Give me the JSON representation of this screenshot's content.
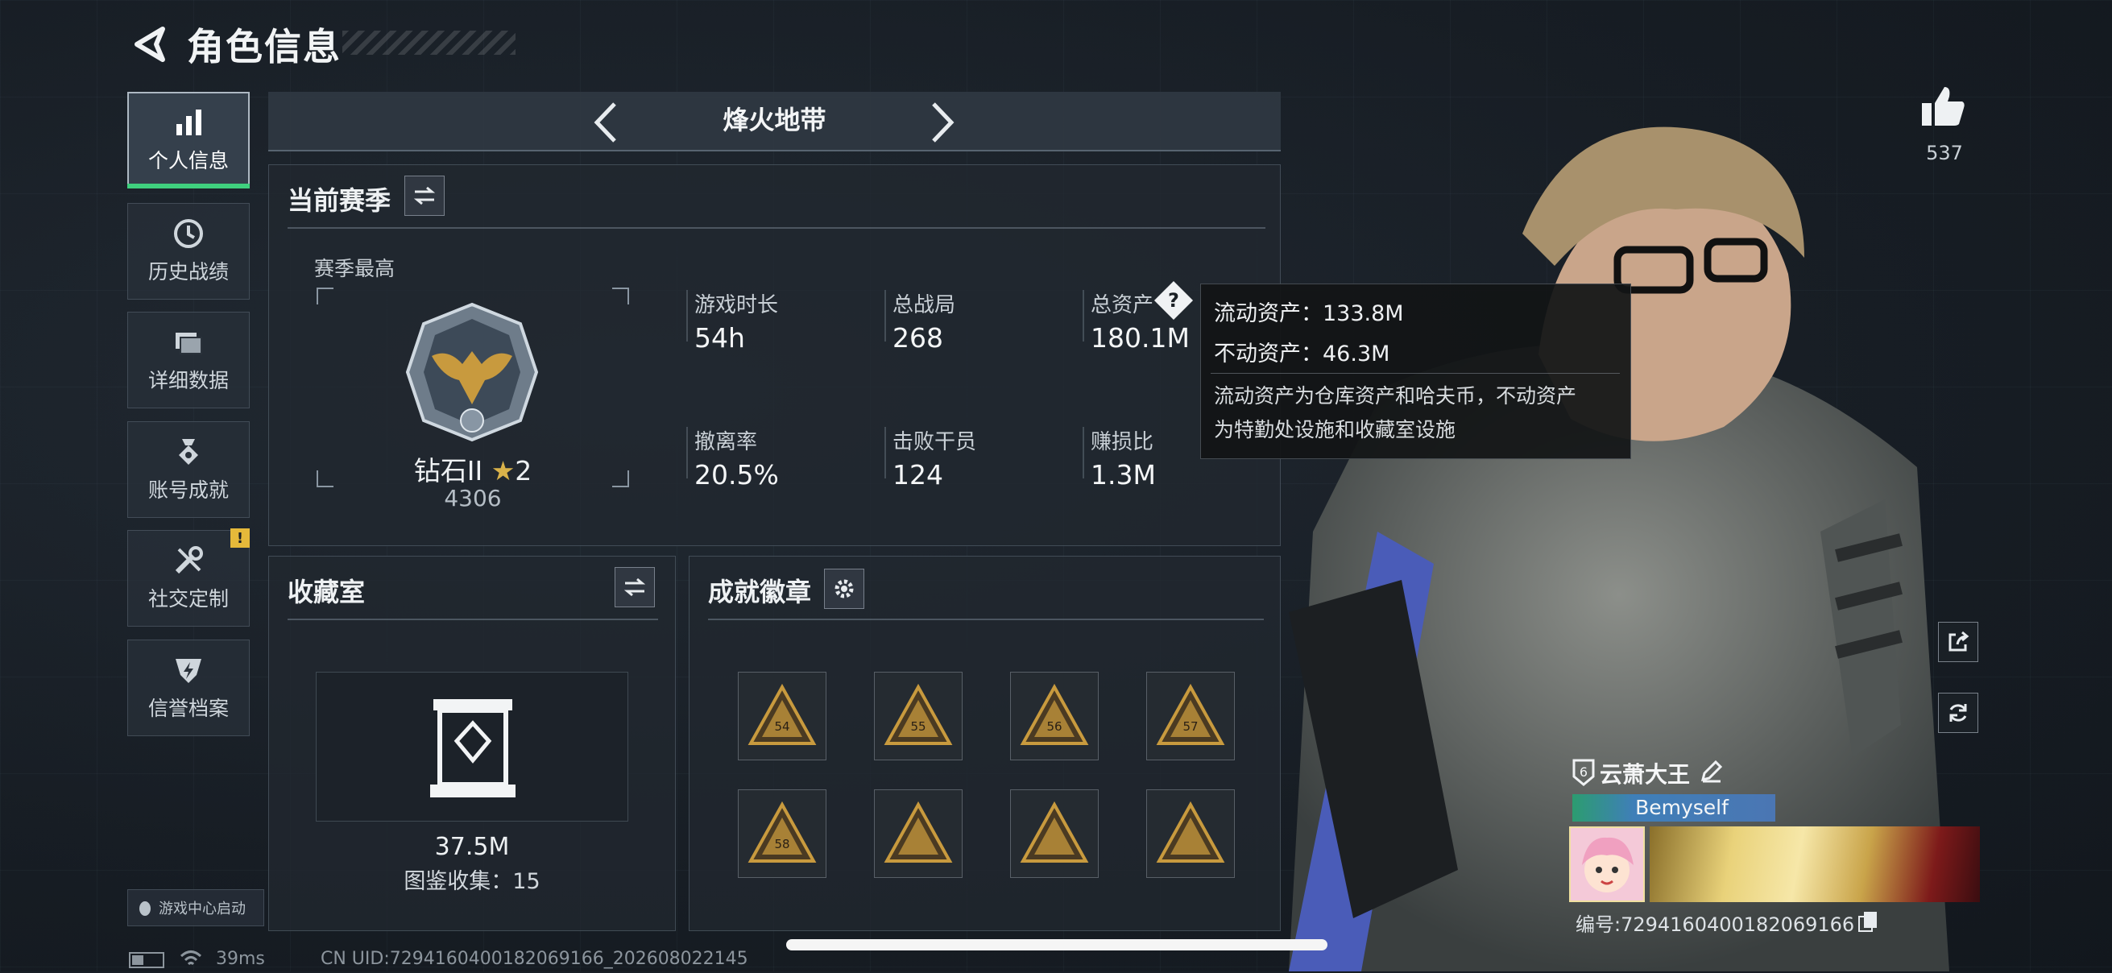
{
  "header": {
    "title": "角色信息"
  },
  "sidebar": {
    "items": [
      {
        "label": "个人信息",
        "icon": "bar-chart-icon",
        "active": true
      },
      {
        "label": "历史战绩",
        "icon": "clock-icon"
      },
      {
        "label": "详细数据",
        "icon": "folder-icon"
      },
      {
        "label": "账号成就",
        "icon": "medal-icon"
      },
      {
        "label": "社交定制",
        "icon": "tools-icon",
        "badge": "!"
      },
      {
        "label": "信誉档案",
        "icon": "shield-bolt-icon"
      }
    ],
    "launch_label": "游戏中心启动"
  },
  "mode": {
    "label": "烽火地带"
  },
  "season": {
    "title": "当前赛季",
    "best_label": "赛季最高",
    "rank_name": "钻石II",
    "rank_stars": "2",
    "rank_score": "4306",
    "stats": [
      {
        "label": "游戏时长",
        "value": "54h"
      },
      {
        "label": "总战局",
        "value": "268"
      },
      {
        "label": "总资产",
        "value": "180.1M"
      },
      {
        "label": "撤离率",
        "value": "20.5%"
      },
      {
        "label": "击败干员",
        "value": "124"
      },
      {
        "label": "赚损比",
        "value": "1.3M"
      }
    ]
  },
  "tooltip": {
    "liquid": "流动资产：133.8M",
    "fixed": "不动资产：46.3M",
    "desc_line1": "流动资产为仓库资产和哈夫币，不动资产",
    "desc_line2": "为特勤处设施和收藏室设施"
  },
  "collection": {
    "title": "收藏室",
    "value": "37.5M",
    "catalog": "图鉴收集：15"
  },
  "achievements": {
    "title": "成就徽章",
    "badges": [
      "54",
      "55",
      "56",
      "57",
      "58",
      "",
      "",
      ""
    ]
  },
  "profile": {
    "likes": "537",
    "name": "云萧大王",
    "subtitle": "Bemyself",
    "id_text": "编号:7294160400182069166"
  },
  "status": {
    "ping": "39ms",
    "uid": "CN UID:7294160400182069166_202608022145"
  },
  "colors": {
    "accent_green": "#3fd07e",
    "warn_yellow": "#e5b93a",
    "badge_gold": "#c89a3e"
  }
}
